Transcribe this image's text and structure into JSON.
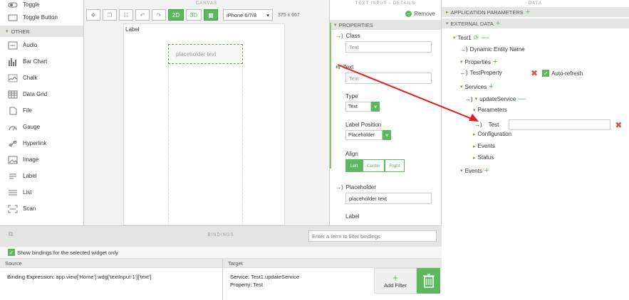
{
  "palette": {
    "items_top": [
      {
        "label": "Toggle",
        "icon": "toggle-icon"
      },
      {
        "label": "Toggle Button",
        "icon": "toggle-button-icon"
      }
    ],
    "section": "OTHER",
    "items": [
      {
        "label": "Audio",
        "icon": "audio-icon"
      },
      {
        "label": "Bar Chart",
        "icon": "bar-chart-icon"
      },
      {
        "label": "Chalk",
        "icon": "chalk-icon"
      },
      {
        "label": "Data Grid",
        "icon": "data-grid-icon"
      },
      {
        "label": "File",
        "icon": "file-icon"
      },
      {
        "label": "Gauge",
        "icon": "gauge-icon"
      },
      {
        "label": "Hyperlink",
        "icon": "hyperlink-icon"
      },
      {
        "label": "Image",
        "icon": "image-icon"
      },
      {
        "label": "Label",
        "icon": "label-icon"
      },
      {
        "label": "List",
        "icon": "list-icon"
      },
      {
        "label": "Scan",
        "icon": "scan-icon"
      }
    ]
  },
  "canvas": {
    "title": "CANVAS",
    "btn_2d": "2D",
    "btn_3d": "3D",
    "device": "iPhone 6/7/8",
    "device_size": "375 x 667",
    "label_widget": "Label",
    "input_placeholder": "placeholder text"
  },
  "details": {
    "title": "TEXT INPUT - DETAILS",
    "remove": "Remove",
    "properties_header": "PROPERTIES",
    "class_label": "Class",
    "class_placeholder": "Text",
    "text_label": "Text",
    "text_placeholder": "Text",
    "type_label": "Type",
    "type_value": "Text",
    "label_position_label": "Label Position",
    "label_position_value": "Placeholder",
    "align_label": "Align",
    "align_left": "Left",
    "align_center": "Center",
    "align_right": "Right",
    "placeholder_label": "Placeholder",
    "placeholder_value": "placeholder text",
    "label_label": "Label"
  },
  "data": {
    "title": "DATA",
    "app_params": "APPLICATION PARAMETERS",
    "external_data": "EXTERNAL DATA",
    "test1": "Test1",
    "dynamic_entity": "Dynamic Entity Name",
    "properties": "Properties",
    "test_property": "TestProperty",
    "auto_refresh": "Auto-refresh",
    "services": "Services",
    "update_service": "updateService",
    "parameters": "Parameters",
    "test": "Test",
    "configuration": "Configuration",
    "events_inner": "Events",
    "status": "Status",
    "events": "Events"
  },
  "bindings": {
    "title": "BINDINGS",
    "filter_placeholder": "Enter a term to filter bindings",
    "show_selected": "Show bindings for the selected widget only",
    "source_header": "Source",
    "target_header": "Target",
    "binding_expression_label": "Binding Expression:",
    "binding_expression": "app.view['Home'].wdg['textInput-1']['text']",
    "service_label": "Service:",
    "service_value": "Test1.updateService",
    "property_label": "Property:",
    "property_value": "Test",
    "add_filter": "Add Filter"
  },
  "colors": {
    "accent": "#5cb85c",
    "danger": "#d9534f",
    "arrow": "#e02020"
  }
}
